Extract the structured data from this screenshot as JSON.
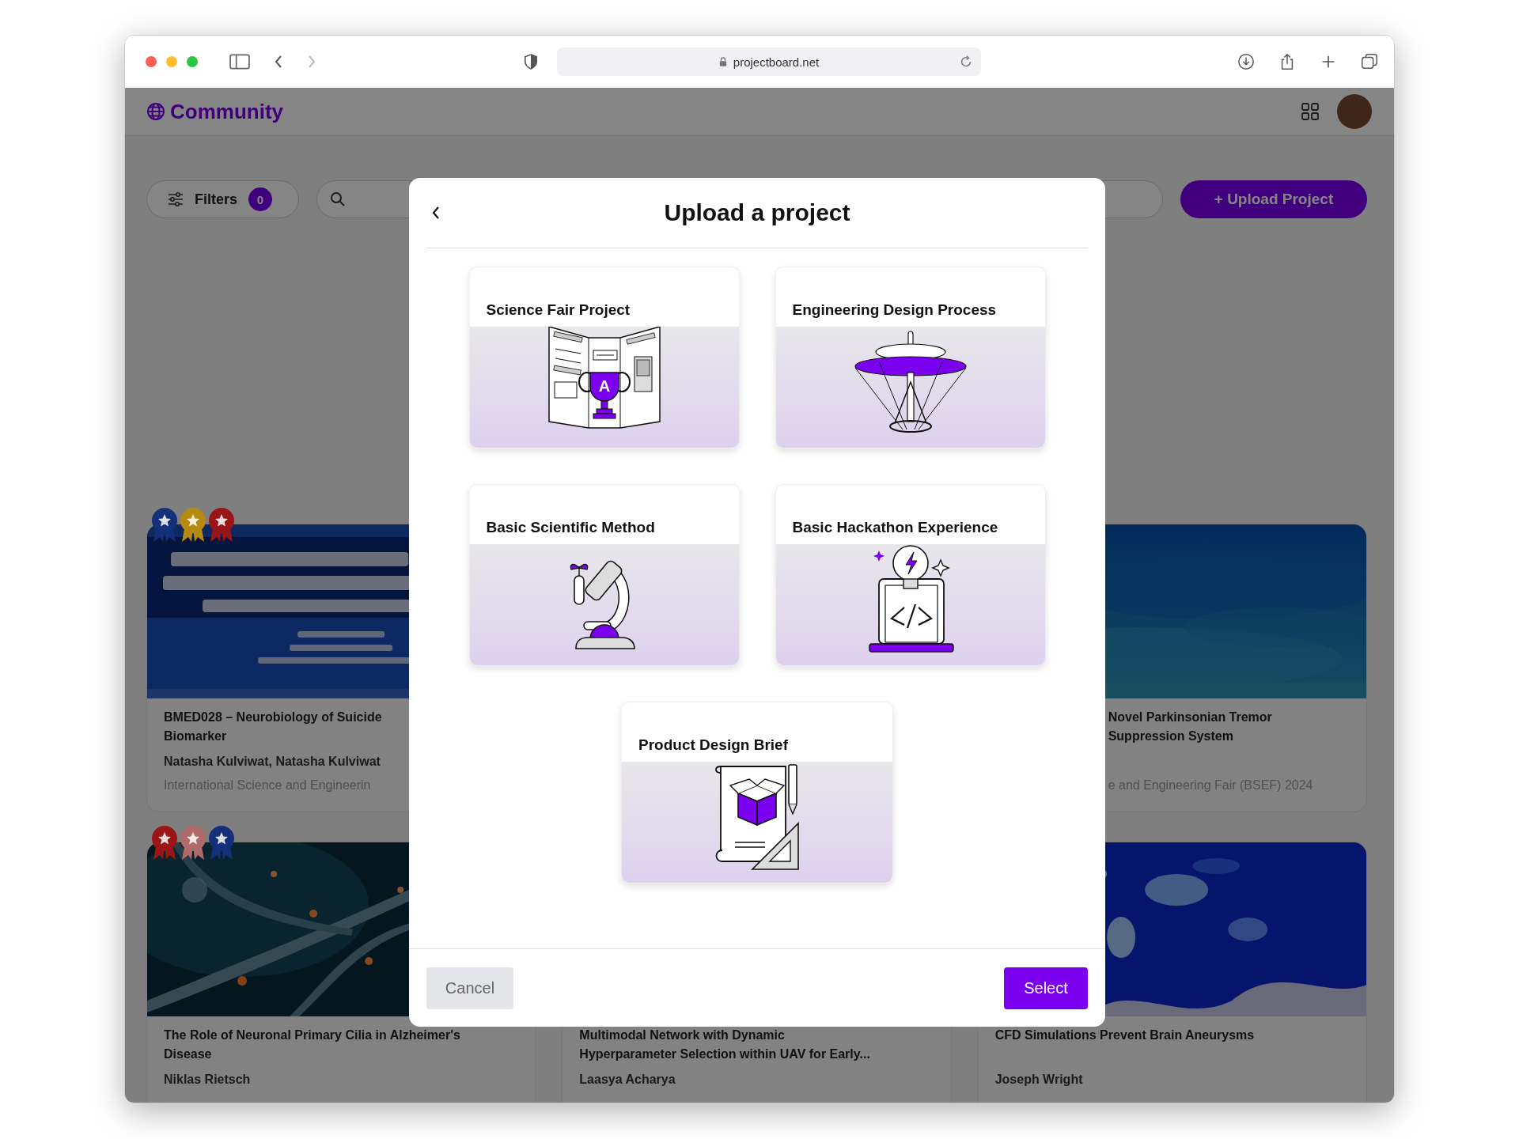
{
  "browser": {
    "url": "projectboard.net"
  },
  "header": {
    "brand": "Community"
  },
  "toolbar": {
    "filters_label": "Filters",
    "filters_count": "0",
    "upload_button": "+ Upload Project"
  },
  "project_rows": [
    [
      {
        "awards": [
          {
            "color": "#15307a"
          },
          {
            "color": "#b58a10"
          },
          {
            "color": "#9a1418"
          }
        ],
        "picture": true,
        "title_lines": [
          "BMED028 – Neurobiology of Suicide",
          "Biomarker"
        ],
        "authors": "Natasha Kulviwat, Natasha Kulviwat",
        "fair": "International Science and Engineerin"
      },
      null,
      {
        "picture": true,
        "title_lines": [
          "Novel Parkinsonian Tremor",
          "Suppression System"
        ],
        "fair": "e and Engineering Fair (BSEF) 2024"
      }
    ],
    [
      {
        "awards": [
          {
            "color": "#9a1418"
          },
          {
            "color": "#b06a6a"
          },
          {
            "color": "#15307a"
          }
        ],
        "picture": true,
        "title_lines": [
          "The Role of Neuronal Primary Cilia in Alzheimer's",
          "Disease"
        ],
        "authors": "Niklas Rietsch"
      },
      {
        "picture": false,
        "title_lines": [
          "Multimodal Network with Dynamic",
          "Hyperparameter Selection within UAV for Early..."
        ],
        "authors": "Laasya Acharya"
      },
      {
        "picture": true,
        "title_lines": [
          "CFD Simulations Prevent Brain Aneurysms"
        ],
        "authors": "Joseph Wright"
      }
    ]
  ],
  "modal": {
    "title": "Upload a project",
    "templates": [
      {
        "name": "Science Fair Project",
        "kind": "trophy",
        "selected": false,
        "trophy_letter": "A"
      },
      {
        "name": "Engineering Design Process",
        "kind": "helicopter",
        "selected": false
      },
      {
        "name": "Basic Scientific Method",
        "kind": "microscope",
        "selected": false
      },
      {
        "name": "Basic Hackathon Experience",
        "kind": "hackathon",
        "selected": false
      },
      {
        "name": "Product Design Brief",
        "kind": "blueprint",
        "selected": false
      }
    ],
    "cancel": "Cancel",
    "select": "Select"
  }
}
